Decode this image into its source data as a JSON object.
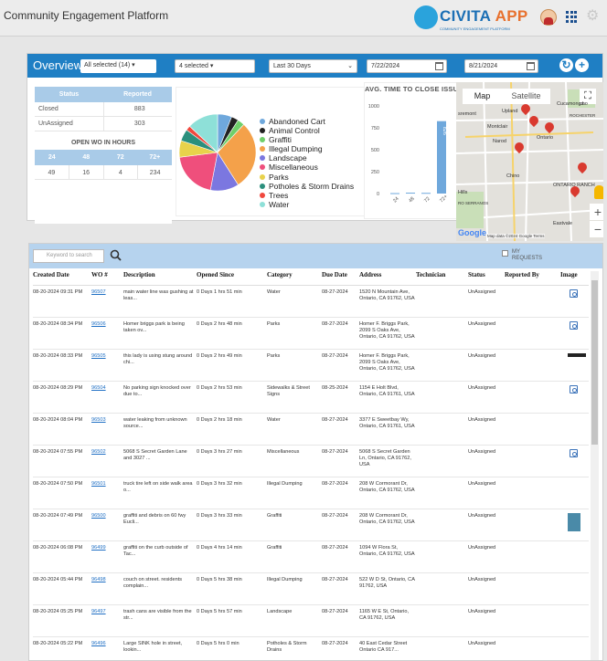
{
  "header": {
    "app_title": "Community Engagement Platform",
    "logo_main": "CIVITA",
    "logo_accent": "APP",
    "logo_tagline": "COMMUNITY ENGAGEMENT PLATFORM",
    "brand_color": "#1b6fb5"
  },
  "filters": {
    "overview_title": "Overview",
    "all_selected": "All selected (14) ▾",
    "four_selected": "4 selected ▾",
    "date_range": "Last 30 Days",
    "start_date": "7/22/2024",
    "end_date": "8/21/2024"
  },
  "stats": {
    "status_header": "Status",
    "reported_header": "Reported",
    "rows": [
      {
        "status": "Closed",
        "count": "883"
      },
      {
        "status": "UnAssigned",
        "count": "303"
      }
    ],
    "open_title": "OPEN WO IN HOURS",
    "hour_headers": [
      "24",
      "48",
      "72",
      "72+"
    ],
    "hour_values": [
      "49",
      "16",
      "4",
      "234"
    ]
  },
  "pie": {
    "legend": [
      {
        "label": "Abandoned Cart",
        "color": "#6fa8dc"
      },
      {
        "label": "Animal Control",
        "color": "#222222"
      },
      {
        "label": "Graffiti",
        "color": "#6fcf6a"
      },
      {
        "label": "Illegal Dumping",
        "color": "#f4a14a"
      },
      {
        "label": "Landscape",
        "color": "#7b77e0"
      },
      {
        "label": "Miscellaneous",
        "color": "#ef4f7c"
      },
      {
        "label": "Parks",
        "color": "#e8d24b"
      },
      {
        "label": "Potholes & Storm Drains",
        "color": "#2b8f7d"
      },
      {
        "label": "Trees",
        "color": "#f0483e"
      },
      {
        "label": "Water",
        "color": "#8ee0d8"
      }
    ],
    "shares": [
      0.06,
      0.03,
      0.03,
      0.29,
      0.12,
      0.2,
      0.07,
      0.05,
      0.02,
      0.13
    ]
  },
  "chart_data": {
    "type": "bar",
    "title": "AVG. TIME TO CLOSE ISSUE",
    "categories": [
      "24",
      "48",
      "72",
      "72+"
    ],
    "values": [
      5,
      10,
      8,
      826
    ],
    "data_label": "826",
    "ylim": [
      0,
      1000
    ],
    "yticks": [
      "1000",
      "750",
      "500",
      "250",
      "0"
    ],
    "bar_color": "#6fa8dc"
  },
  "map": {
    "map_tab": "Map",
    "satellite_tab": "Satellite",
    "labels": [
      "Upland",
      "Montclair",
      "Ontario",
      "Chino",
      "ONTARIO RANCH",
      "Eastvale",
      "Cucamonga",
      "ROCHESTER",
      "Narod",
      "Hills",
      "RO SERRANOS",
      "sremont",
      "cho"
    ],
    "attribution": "Map data ©2024 Google  Terms",
    "google": "Google"
  },
  "list": {
    "search_placeholder": "Keyword to search",
    "my_requests": "MY REQUESTS",
    "columns": [
      "Created Date",
      "WO #",
      "Description",
      "Opened Since",
      "Category",
      "Due Date",
      "Address",
      "Technician",
      "Status",
      "Reported By",
      "Image"
    ],
    "rows": [
      {
        "date": "08-20-2024 09:31 PM",
        "wo": "96507",
        "desc": "main water line was gushing at leas...",
        "opened": "0 Days 1 hrs 51 min",
        "cat": "Water",
        "due": "08-27-2024",
        "addr": "1520 N Mountain Ave, Ontario, CA 91762, USA",
        "status": "UnAssigned"
      },
      {
        "date": "08-20-2024 08:34 PM",
        "wo": "96506",
        "desc": "Homer briggs park is being taken ov...",
        "opened": "0 Days 2 hrs 48 min",
        "cat": "Parks",
        "due": "08-27-2024",
        "addr": "Homer F. Briggs Park, 2099 S Oaks Ave, Ontario, CA 91762, USA",
        "status": "UnAssigned"
      },
      {
        "date": "08-20-2024 08:33 PM",
        "wo": "96505",
        "desc": "this lady is using stung around chi...",
        "opened": "0 Days 2 hrs 49 min",
        "cat": "Parks",
        "due": "08-27-2024",
        "addr": "Homer F. Briggs Park, 2099 S Oaks Ave, Ontario, CA 91762, USA",
        "status": "UnAssigned"
      },
      {
        "date": "08-20-2024 08:29 PM",
        "wo": "96504",
        "desc": "No parking sign knocked over due to...",
        "opened": "0 Days 2 hrs 53 min",
        "cat": "Sidewalks & Street Signs",
        "due": "08-25-2024",
        "addr": "1154 E Holt Blvd, Ontario, CA 91761, USA",
        "status": "UnAssigned"
      },
      {
        "date": "08-20-2024 08:04 PM",
        "wo": "96503",
        "desc": "water leaking from unknown source...",
        "opened": "0 Days 2 hrs 18 min",
        "cat": "Water",
        "due": "08-27-2024",
        "addr": "3377 E Sweetbay Wy, Ontario, CA 91761, USA",
        "status": "UnAssigned"
      },
      {
        "date": "08-20-2024 07:55 PM",
        "wo": "96502",
        "desc": "5068 S Secret Garden Lane and 3027 ...",
        "opened": "0 Days 3 hrs 27 min",
        "cat": "Miscellaneous",
        "due": "08-27-2024",
        "addr": "5068 S Secret Garden Ln, Ontario, CA 91762, USA",
        "status": "UnAssigned"
      },
      {
        "date": "08-20-2024 07:50 PM",
        "wo": "96501",
        "desc": "truck tire left on side walk area o...",
        "opened": "0 Days 3 hrs 32 min",
        "cat": "Illegal Dumping",
        "due": "08-27-2024",
        "addr": "208 W Cormorant Dr, Ontario, CA 91762, USA",
        "status": "UnAssigned"
      },
      {
        "date": "08-20-2024 07:49 PM",
        "wo": "96500",
        "desc": "graffiti and debris on 60 fwy Eucli...",
        "opened": "0 Days 3 hrs 33 min",
        "cat": "Graffiti",
        "due": "08-27-2024",
        "addr": "208 W Cormorant Dr, Ontario, CA 91762, USA",
        "status": "UnAssigned"
      },
      {
        "date": "08-20-2024 06:08 PM",
        "wo": "96499",
        "desc": "graffiti on the curb outside of Tac...",
        "opened": "0 Days 4 hrs 14 min",
        "cat": "Graffiti",
        "due": "08-27-2024",
        "addr": "1094 W Flora St, Ontario, CA 91762, USA",
        "status": "UnAssigned"
      },
      {
        "date": "08-20-2024 05:44 PM",
        "wo": "96498",
        "desc": "couch on street. residents complain...",
        "opened": "0 Days 5 hrs 38 min",
        "cat": "Illegal Dumping",
        "due": "08-27-2024",
        "addr": "522 W D St, Ontario, CA 91762, USA",
        "status": "UnAssigned"
      },
      {
        "date": "08-20-2024 05:25 PM",
        "wo": "96497",
        "desc": "trash cans are visible from the str...",
        "opened": "0 Days 5 hrs 57 min",
        "cat": "Landscape",
        "due": "08-27-2024",
        "addr": "1165 W E St, Ontario, CA 91762, USA",
        "status": "UnAssigned"
      },
      {
        "date": "08-20-2024 05:22 PM",
        "wo": "96496",
        "desc": "Large SINK hole in street, lookin...",
        "opened": "0 Days 5 hrs 0 min",
        "cat": "Potholes & Storm Drains",
        "due": "08-27-2024",
        "addr": "40 East Cedar Street Ontario CA 917...",
        "status": "UnAssigned"
      }
    ],
    "image_kinds": [
      "icon",
      "icon",
      "dark",
      "icon",
      "",
      "icon",
      "",
      "photo",
      "",
      "",
      "",
      ""
    ]
  }
}
